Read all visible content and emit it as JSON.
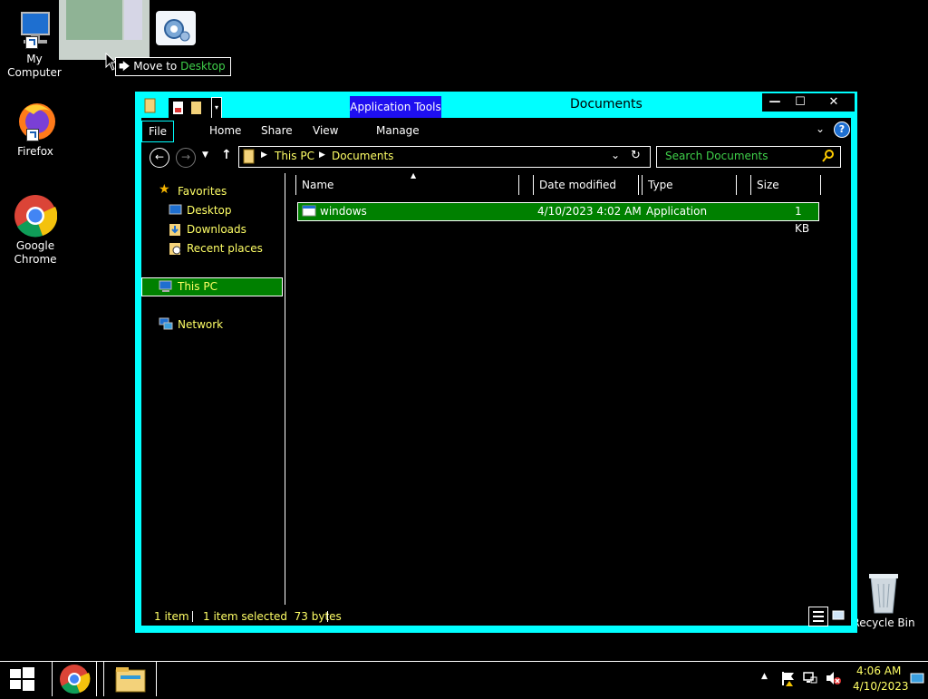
{
  "desktop": {
    "icons": [
      {
        "label": "My Computer"
      },
      {
        "label": "Firefox"
      },
      {
        "label": "Google Chrome"
      },
      {
        "label": "Recycle Bin"
      }
    ],
    "drag_tooltip": {
      "prefix": "Move to",
      "target": "Desktop"
    }
  },
  "window": {
    "title": "Documents",
    "contextual_tab": "Application Tools",
    "controls": {
      "minimize": "—",
      "maximize": "☐",
      "close": "✕"
    },
    "tabs": [
      "File",
      "Home",
      "Share",
      "View",
      "Manage"
    ],
    "help": "?",
    "address": {
      "crumbs": [
        "This PC",
        "Documents"
      ]
    },
    "search": {
      "placeholder": "Search Documents"
    },
    "nav": {
      "favorites_label": "Favorites",
      "favorites": [
        "Desktop",
        "Downloads",
        "Recent places"
      ],
      "this_pc": "This PC",
      "network": "Network"
    },
    "columns": [
      "Name",
      "Date modified",
      "Type",
      "Size"
    ],
    "files": [
      {
        "name": "windows",
        "date": "4/10/2023 4:02 AM",
        "type": "Application",
        "size": "1 KB"
      }
    ],
    "status": {
      "count": "1 item",
      "selected": "1 item selected  73 bytes"
    }
  },
  "taskbar": {
    "time": "4:06 AM",
    "date": "4/10/2023"
  },
  "colors": {
    "frame": "#00ffff",
    "selection": "#008000",
    "link_text": "#ffff66",
    "contextual": "#1e0ff0"
  }
}
